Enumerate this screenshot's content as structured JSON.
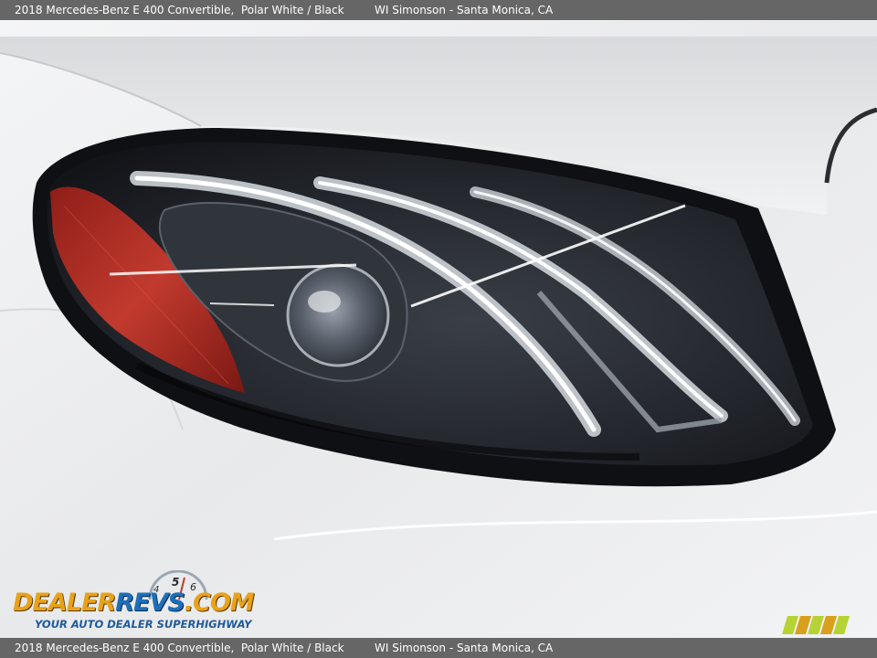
{
  "caption": {
    "vehicle": "2018 Mercedes-Benz E 400 Convertible,",
    "color": "Polar White / Black",
    "dealer": "WI Simonson - Santa Monica, CA"
  },
  "watermark": {
    "brand_part1": "DEALER",
    "brand_part2": "REVS",
    "brand_part3": ".COM",
    "tagline": "YOUR AUTO DEALER SUPERHIGHWAY",
    "gauge_digits": [
      "4",
      "5",
      "6"
    ]
  },
  "photo": {
    "subject": "headlight",
    "colors": {
      "paint": "#eceef0",
      "lens": "#2a2d33",
      "reflector": "#c0392b",
      "bar_bg": "#666666"
    }
  }
}
